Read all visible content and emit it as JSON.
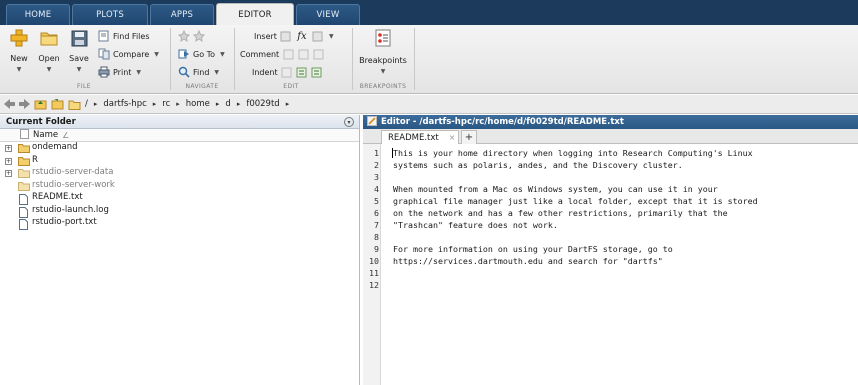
{
  "tabs": [
    "HOME",
    "PLOTS",
    "APPS",
    "EDITOR",
    "VIEW"
  ],
  "active_tab": "EDITOR",
  "ribbon": {
    "file": {
      "label": "FILE",
      "new": "New",
      "open": "Open",
      "save": "Save",
      "find_files": "Find Files",
      "compare": "Compare",
      "print": "Print"
    },
    "navigate": {
      "label": "NAVIGATE",
      "go_to": "Go To",
      "find": "Find"
    },
    "edit": {
      "label": "EDIT",
      "insert": "Insert",
      "comment": "Comment",
      "indent": "Indent"
    },
    "breakpoints": {
      "label": "BREAKPOINTS",
      "button": "Breakpoints"
    }
  },
  "address_bar": {
    "root": "/",
    "crumbs": [
      "dartfs-hpc",
      "rc",
      "home",
      "d",
      "f0029td"
    ]
  },
  "current_folder": {
    "title": "Current Folder",
    "column_header": "Name",
    "sort_indicator": "∠",
    "items": [
      {
        "name": "ondemand",
        "type": "folder",
        "expandable": true,
        "dimmed": false
      },
      {
        "name": "R",
        "type": "folder",
        "expandable": true,
        "dimmed": false
      },
      {
        "name": "rstudio-server-data",
        "type": "folder",
        "expandable": true,
        "dimmed": true
      },
      {
        "name": "rstudio-server-work",
        "type": "folder",
        "expandable": false,
        "dimmed": true
      },
      {
        "name": "README.txt",
        "type": "file",
        "expandable": false,
        "dimmed": false
      },
      {
        "name": "rstudio-launch.log",
        "type": "file",
        "expandable": false,
        "dimmed": false
      },
      {
        "name": "rstudio-port.txt",
        "type": "file",
        "expandable": false,
        "dimmed": false
      }
    ]
  },
  "editor": {
    "title": "Editor - /dartfs-hpc/rc/home/d/f0029td/README.txt",
    "tab_label": "README.txt",
    "tab_close": "×",
    "add_tab": "+",
    "lines": [
      "This is your home directory when logging into Research Computing's Linux",
      "systems such as polaris, andes, and the Discovery cluster.",
      "",
      "When mounted from a Mac os Windows system, you can use it in your",
      "graphical file manager just like a local folder, except that it is stored",
      "on the network and has a few other restrictions, primarily that the",
      "\"Trashcan\" feature does not work.",
      "",
      "For more information on using your DartFS storage, go to",
      "https://services.dartmouth.edu and search for \"dartfs\"",
      "",
      ""
    ],
    "line_numbers": [
      "1",
      "2",
      "3",
      "4",
      "5",
      "6",
      "7",
      "8",
      "9",
      "10",
      "11",
      "12"
    ]
  },
  "colors": {
    "tabbar_bg": "#1c3a5c",
    "editor_title_bg": "#2a5783",
    "folder_yellow": "#e8c45a"
  }
}
